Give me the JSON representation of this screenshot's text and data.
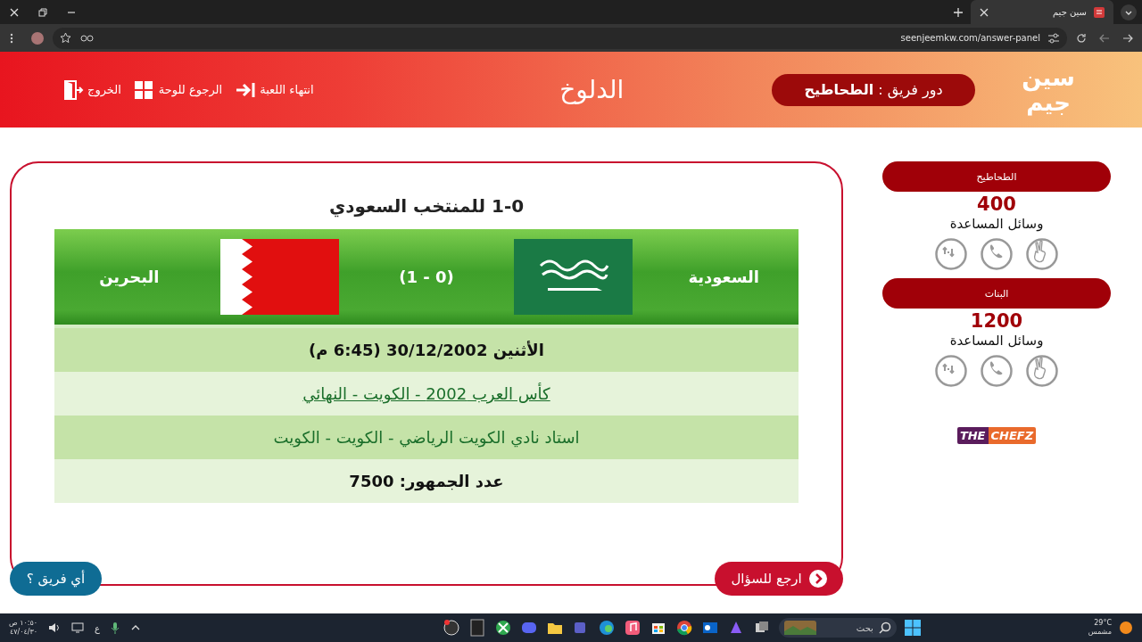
{
  "browser": {
    "tab_title": "سين جيم",
    "url": "seenjeemkw.com/answer-panel"
  },
  "header": {
    "logo": "سين جيم",
    "turn": "دور فريق : **الطحاطيح**",
    "title": "الدلوخ",
    "links": [
      {
        "kind": "end",
        "label": "انتهاء اللعبة"
      },
      {
        "kind": "board",
        "label": "الرجوع للوحة"
      },
      {
        "kind": "exit",
        "label": "الخروج"
      }
    ]
  },
  "teams": [
    {
      "name": "الطحاطيح",
      "score": "400",
      "helps_label": "وسائل المساعدة",
      "helps": [
        {
          "kind": "two"
        },
        {
          "kind": "call"
        },
        {
          "kind": "swap"
        }
      ]
    },
    {
      "name": "البنات",
      "score": "1200",
      "helps_label": "وسائل المساعدة",
      "helps": [
        {
          "kind": "two"
        },
        {
          "kind": "call"
        },
        {
          "kind": "swap"
        }
      ]
    }
  ],
  "sponsor": {
    "left": "THE",
    "right": "CHEFZ"
  },
  "answer": {
    "title": "1-0 للمنتخب السعودي",
    "home": {
      "name": "السعودية",
      "kind": "sa"
    },
    "score": "(1 - 0)",
    "away": {
      "name": "البحرين",
      "kind": "bh"
    },
    "rows": [
      {
        "kind": "plain",
        "text": "الأثنين 30/12/2002 (6:45 م)"
      },
      {
        "kind": "link",
        "text": "كأس العرب 2002 - الكويت - النهائي"
      },
      {
        "kind": "green",
        "text": "استاد نادي الكويت الرياضي - الكويت - الكويت"
      },
      {
        "kind": "plain",
        "text": "عدد الجمهور: 7500"
      }
    ]
  },
  "buttons": {
    "back": "ارجع للسؤال",
    "which": "أي فريق ؟"
  },
  "taskbar": {
    "search": "بحث",
    "weather_temp": "29°C",
    "weather_text": "مشمس",
    "keyboard": "ع",
    "time": "١٠:٥٠ ص",
    "date": "٤٧/٠٤/٣٠"
  }
}
